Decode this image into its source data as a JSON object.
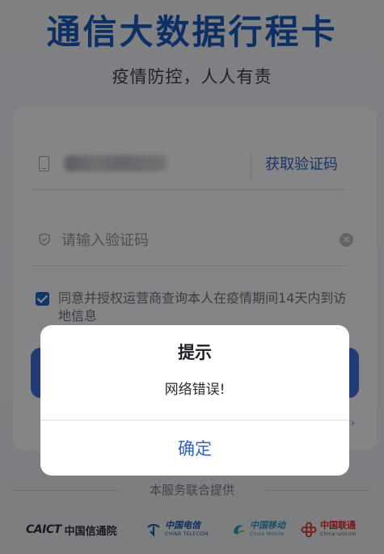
{
  "header": {
    "title": "通信大数据行程卡",
    "subtitle": "疫情防控，人人有责"
  },
  "form": {
    "get_code_label": "获取验证码",
    "code_placeholder": "请输入验证码",
    "agreement_text": "同意并授权运营商查询本人在疫情期间14天内到访地信息",
    "agreement_checked": true
  },
  "footer": {
    "provided_by": "本服务联合提供",
    "partners": {
      "caict_logo": "CAICT",
      "caict_name": "中国信通院",
      "telecom_cn": "中国电信",
      "telecom_en": "CHINA TELECOM",
      "mobile_cn": "中国移动",
      "mobile_en": "China Mobile",
      "unicom_cn": "中国联通",
      "unicom_en": "China unicom"
    }
  },
  "dialog": {
    "title": "提示",
    "message": "网络错误!",
    "confirm_label": "确定"
  },
  "colors": {
    "brand_blue": "#1a57b6",
    "checkbox_blue": "#2060c4",
    "confirm_blue": "#2d62c4"
  },
  "icons": {
    "phone": "phone-icon",
    "shield": "shield-icon",
    "clear": "clear-icon",
    "checkbox": "checkbox-checked-icon"
  }
}
